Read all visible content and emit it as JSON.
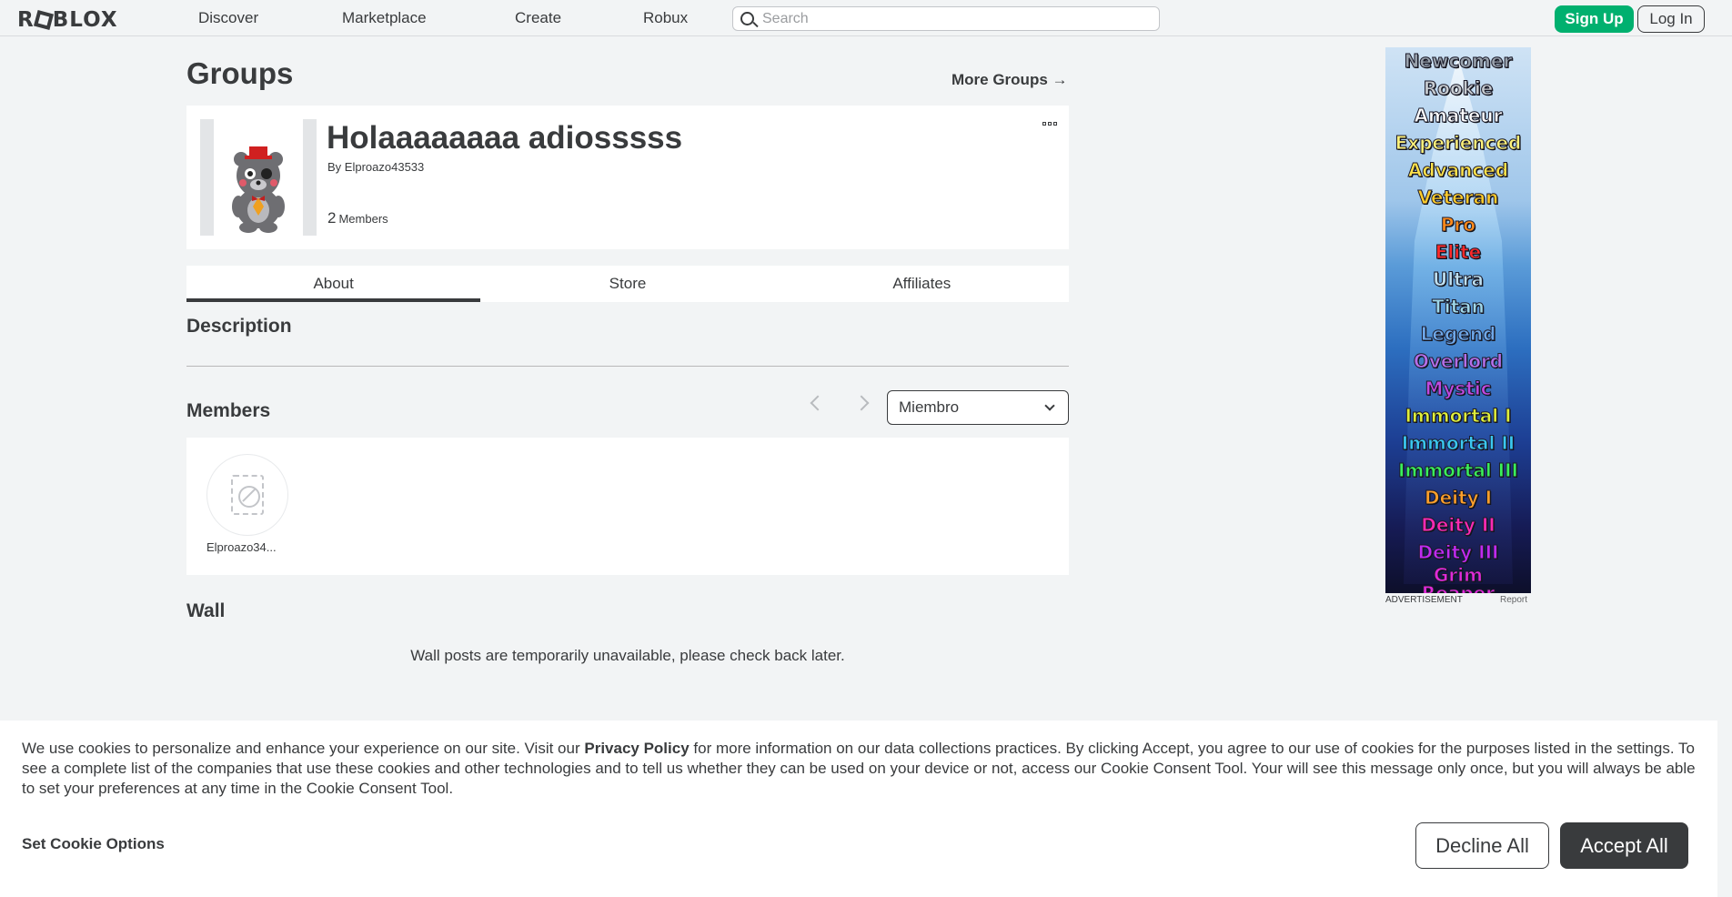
{
  "header": {
    "logo": "ROBLOX",
    "nav": [
      "Discover",
      "Marketplace",
      "Create",
      "Robux"
    ],
    "search_placeholder": "Search",
    "signup_label": "Sign Up",
    "login_label": "Log In"
  },
  "page": {
    "title": "Groups",
    "more_groups": "More Groups →"
  },
  "group": {
    "name": "Holaaaaaaaa adiosssss",
    "by_prefix": "By",
    "owner": "Elproazo43533",
    "member_count": "2",
    "members_label": "Members"
  },
  "tabs": [
    "About",
    "Store",
    "Affiliates"
  ],
  "sections": {
    "description": "Description",
    "members": "Members",
    "wall": "Wall"
  },
  "members": {
    "role_selected": "Miembro",
    "list": [
      {
        "name": "Elproazo34..."
      }
    ]
  },
  "wall": {
    "message": "Wall posts are temporarily unavailable, please check back later."
  },
  "ad": {
    "label": "ADVERTISEMENT",
    "report": "Report",
    "ranks": [
      {
        "text": "Newcomer",
        "color": "#9aa3ad"
      },
      {
        "text": "Rookie",
        "color": "#c8ccd0"
      },
      {
        "text": "Amateur",
        "color": "#ffffff"
      },
      {
        "text": "Experienced",
        "color": "#fff27a"
      },
      {
        "text": "Advanced",
        "color": "#ffe24a"
      },
      {
        "text": "Veteran",
        "color": "#ffcc2a"
      },
      {
        "text": "Pro",
        "color": "#ff8a1a"
      },
      {
        "text": "Elite",
        "color": "#ff2a2a"
      },
      {
        "text": "Ultra",
        "color": "#bfe0f0"
      },
      {
        "text": "Titan",
        "color": "#9fd8ea"
      },
      {
        "text": "Legend",
        "color": "#6fa8e8"
      },
      {
        "text": "Overlord",
        "color": "#b46fe8"
      },
      {
        "text": "Mystic",
        "color": "#c04ae0"
      },
      {
        "text": "Immortal I",
        "color": "#e0f03a"
      },
      {
        "text": "Immortal II",
        "color": "#3ac8f0"
      },
      {
        "text": "Immortal III",
        "color": "#3af05a"
      },
      {
        "text": "Deity I",
        "color": "#ffa02a"
      },
      {
        "text": "Deity II",
        "color": "#ff2ab4"
      },
      {
        "text": "Deity III",
        "color": "#c02af0"
      },
      {
        "text": "Grim Reaper",
        "color": "#e02ad8"
      }
    ]
  },
  "cookie": {
    "text_before": "We use cookies to personalize and enhance your experience on our site. Visit our ",
    "privacy_link": "Privacy Policy",
    "text_after": " for more information on our data collections practices. By clicking Accept, you agree to our use of cookies for the purposes listed in the settings. To see a complete list of the companies that use these cookies and other technologies and to tell us whether they can be used on your device or not, access our Cookie Consent Tool. Your will see this message only once, but you will always be able to set your preferences at any time in the Cookie Consent Tool.",
    "options_label": "Set Cookie Options",
    "decline_label": "Decline All",
    "accept_label": "Accept All"
  },
  "colors": {
    "accent_green": "#00b06f",
    "text_dark": "#393b3d",
    "bg": "#f2f4f5"
  }
}
